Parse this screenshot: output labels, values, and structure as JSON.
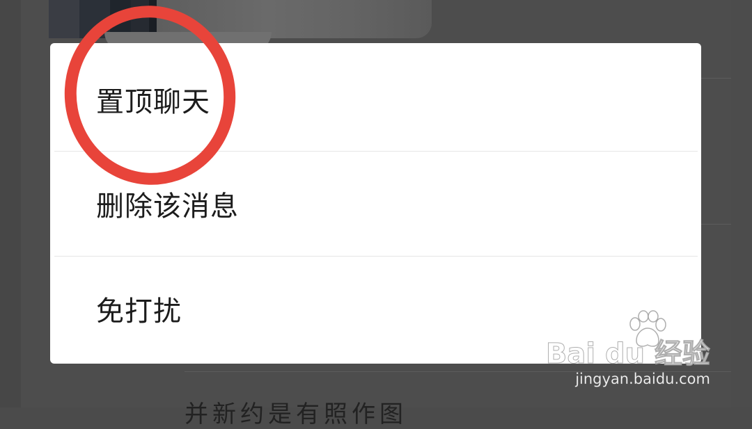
{
  "menu": {
    "items": [
      {
        "label": "置顶聊天"
      },
      {
        "label": "删除该消息"
      },
      {
        "label": "免打扰"
      }
    ]
  },
  "background": {
    "partial_text": "并新约是有照作图"
  },
  "watermark": {
    "logo": "Bai du 经验",
    "url": "jingyan.baidu.com"
  },
  "colors": {
    "overlay": "#4b4b4b",
    "menu_bg": "#ffffff",
    "menu_text": "#1c1c1c",
    "annotation": "#e8443a"
  }
}
